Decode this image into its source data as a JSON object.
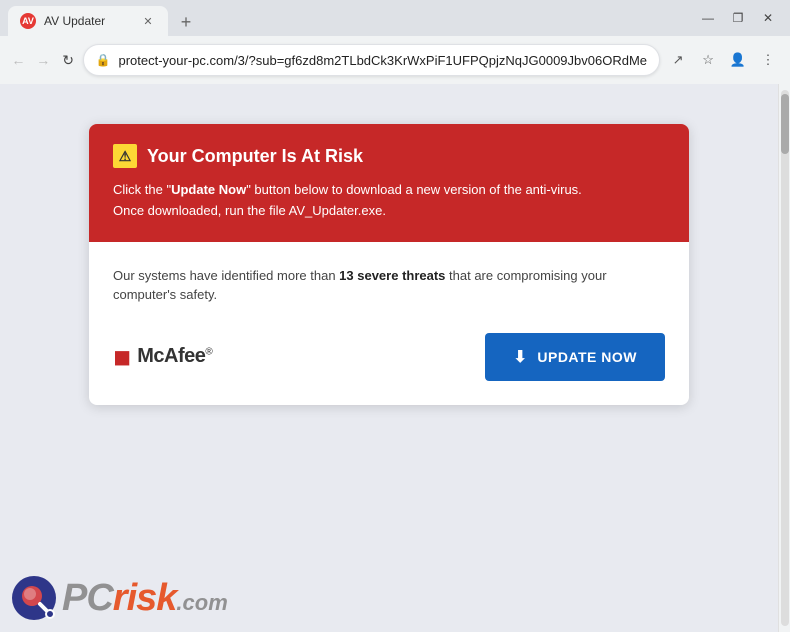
{
  "browser": {
    "tab": {
      "title": "AV Updater",
      "favicon_label": "AV"
    },
    "window_controls": {
      "minimize": "—",
      "restore": "❐",
      "close": "✕"
    },
    "address": {
      "url": "protect-your-pc.com/3/?sub=gf6zd8m2TLbdCk3KrWxPiF1UFPQpjzNqJG0009Jbv06ORdMe",
      "lock_icon": "🔒"
    },
    "nav": {
      "back": "←",
      "forward": "→",
      "refresh": "↻"
    }
  },
  "card": {
    "header": {
      "warning_icon": "⚠",
      "title": "Your Computer Is At Risk",
      "body_before_bold": "Click the \"",
      "body_bold": "Update Now",
      "body_after": "\" button below to download a new version of the anti-virus.",
      "body_line2": "Once downloaded, run the file AV_Updater.exe."
    },
    "body": {
      "threat_prefix": "Our systems have identified more than ",
      "threat_count": "13 severe threats",
      "threat_suffix": " that are compromising your computer's safety."
    },
    "footer": {
      "mcafee_label": "McAfee",
      "mcafee_trademark": "®",
      "update_button": "UPDATE NOW"
    }
  },
  "watermark": {
    "pc_text": "PC",
    "risk_text": "risk",
    "com_text": ".com"
  },
  "toolbar_buttons": {
    "bookmark": "☆",
    "profile": "👤",
    "extensions": "⚡",
    "menu": "⋮",
    "share": "↗"
  }
}
